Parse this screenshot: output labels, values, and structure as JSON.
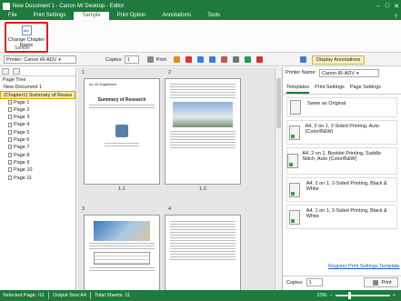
{
  "window": {
    "title": "New Document 1 - Canon iW Desktop - Editor",
    "controls": [
      "–",
      "□",
      "✕"
    ]
  },
  "menu": {
    "tabs": [
      "File",
      "Print Settings",
      "Sample",
      "Print Option",
      "Annotations",
      "Tools"
    ],
    "active": "Sample",
    "help": "?"
  },
  "ribbon": {
    "change_chapter_name_label": "Change Chapter Name",
    "group_label": "Sample"
  },
  "toolbar": {
    "printer_label": "Printer: Canon iR-ADV",
    "copies_label": "Copies:",
    "copies_value": "1",
    "print_label": "Print",
    "display_annotations_label": "Display Annotations"
  },
  "left_pane": {
    "tree_title": "Page Tree",
    "document": "New Document 1",
    "chapter": "(Chapter1) Summary of Resea",
    "pages": [
      "Page 1",
      "Page 2",
      "Page 3",
      "Page 4",
      "Page 5",
      "Page 6",
      "Page 7",
      "Page 8",
      "Page 9",
      "Page 10",
      "Page 11"
    ]
  },
  "center": {
    "sheet_numbers": [
      "1",
      "2",
      "3",
      "4"
    ],
    "page_labels": [
      "1-1",
      "1-2"
    ],
    "page1_heading": "Summary of Research",
    "page1_sub": "No. 45 Supplement"
  },
  "right_pane": {
    "printer_label": "Printer Name:",
    "printer_value": "Canon iR-ADV",
    "tabs": [
      "Templates",
      "Print Settings",
      "Page Settings"
    ],
    "active_tab": "Templates",
    "templates": [
      "Same as Original",
      "A4, 2 on 1, 2-Sided Printing, Auto (Color/B&W)",
      "A4, 2 on 1, Booklet Printing, Saddle Stitch, Auto (Color/B&W)",
      "A4, 2 on 1, 2-Sided Printing, Black & White",
      "A4, 1 on 1, 2-Sided Printing, Black & White"
    ],
    "register_link": "Register Print Settings Template",
    "copies_label": "Copies:",
    "copies_value": "1",
    "print_label": "Print"
  },
  "status": {
    "selected_page": "Selected Page: /11",
    "output_size": "Output Size:A4",
    "total_sheets": "Total Sheets: 11",
    "zoom": "23%"
  },
  "colors": {
    "brand": "#1e7a3e",
    "highlight": "#e11111",
    "selection": "#fbe9a7"
  }
}
